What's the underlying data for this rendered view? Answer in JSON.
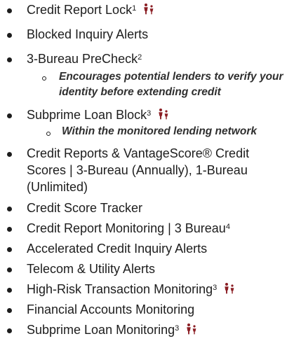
{
  "features": [
    {
      "label": "Credit Report Lock",
      "sup": "1",
      "family_icon": true
    },
    {
      "label": "Blocked Inquiry Alerts",
      "sup": "",
      "family_icon": false
    },
    {
      "label": "3-Bureau PreCheck",
      "sup": "2",
      "family_icon": false
    },
    {
      "label": "Encourages potential lenders to verify your",
      "label2": "identity before extending credit"
    },
    {
      "label": "Subprime Loan Block",
      "sup": "3",
      "family_icon": true
    },
    {
      "label": "Within the monitored lending network"
    },
    {
      "label": "Credit Reports & VantageScore® Credit",
      "label2": "Scores | 3-Bureau (Annually), 1-Bureau",
      "label3": "(Unlimited)"
    },
    {
      "label": "Credit Score Tracker"
    },
    {
      "label": "Credit Report Monitoring | 3 Bureau",
      "sup": "4"
    },
    {
      "label": "Accelerated Credit Inquiry Alerts"
    },
    {
      "label": "Telecom & Utility Alerts"
    },
    {
      "label": "High-Risk Transaction Monitoring",
      "sup": "3",
      "family_icon": true
    },
    {
      "label": "Financial Accounts Monitoring"
    },
    {
      "label": "Subprime Loan Monitoring",
      "sup": "3",
      "family_icon": true
    }
  ],
  "icons": {
    "family_icon_name": "family-icon",
    "family_icon_color": "#8b1e24"
  }
}
